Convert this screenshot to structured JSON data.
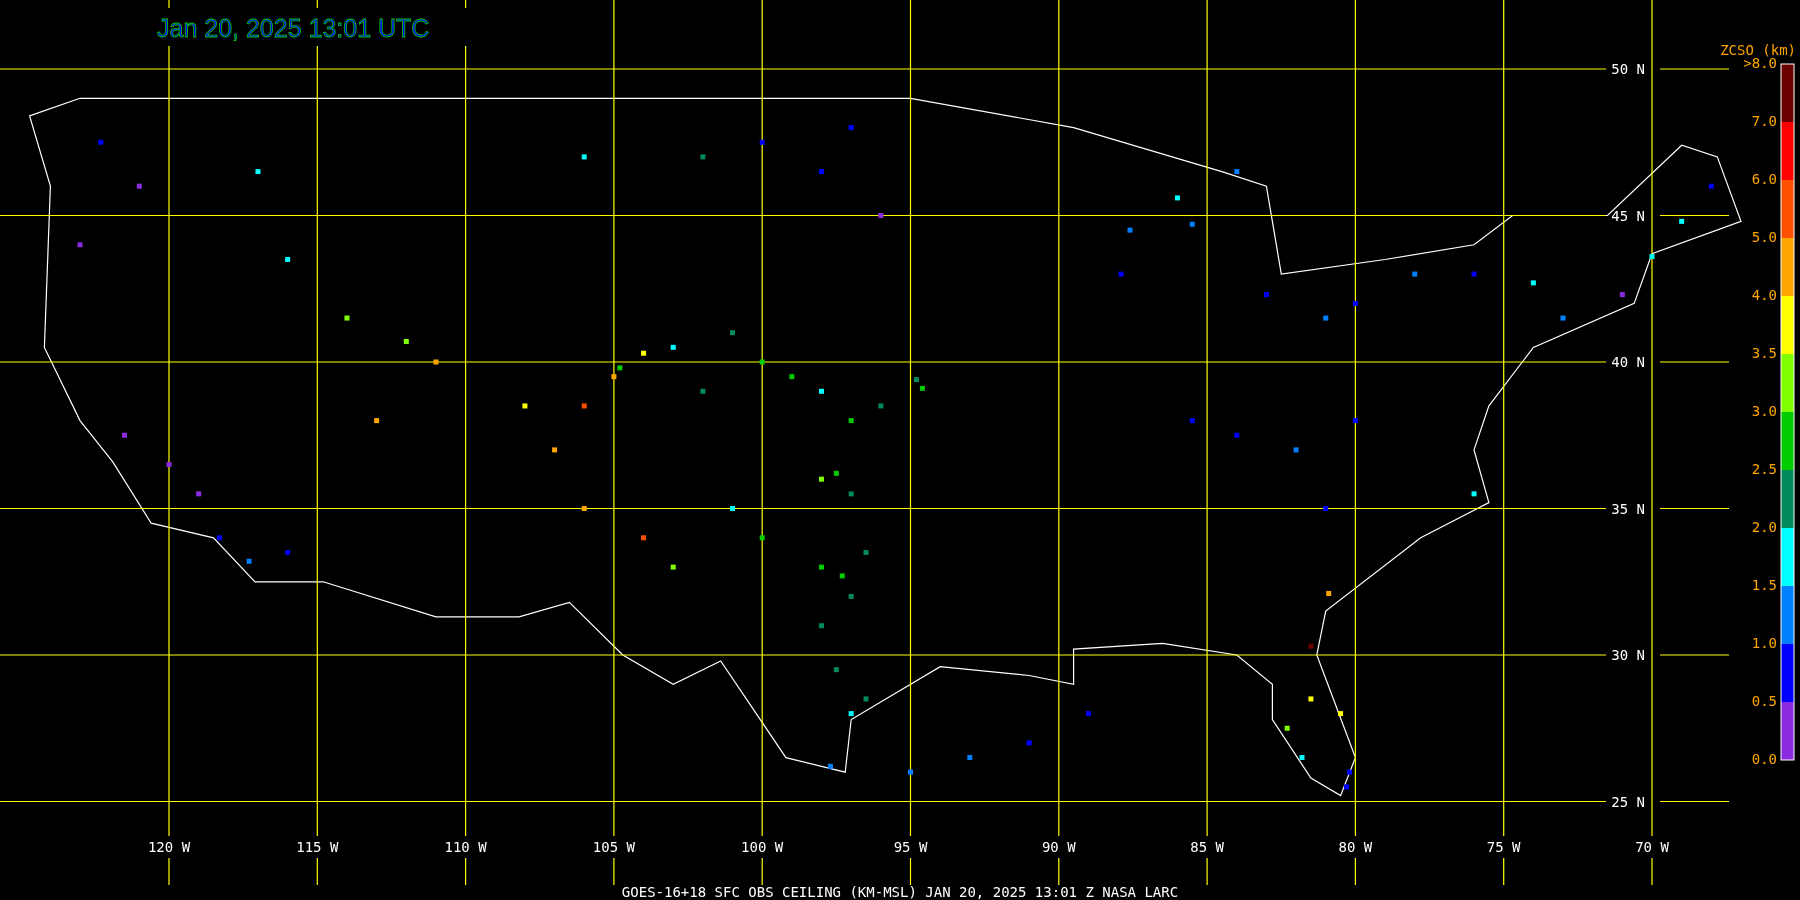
{
  "title": "Jan 20, 2025 13:01 UTC",
  "lat_labels": [
    "50 N",
    "45 N",
    "40 N",
    "35 N",
    "30 N",
    "25 N"
  ],
  "lon_labels": [
    "120 W",
    "115 W",
    "110 W",
    "105 W",
    "100 W",
    "95 W",
    "90 W",
    "85 W",
    "80 W",
    "75 W",
    "70 W"
  ],
  "legend": {
    "title": "ZCSO (km)",
    "labels": [
      ">8.0",
      "7.0",
      "6.0",
      "5.0",
      "4.0",
      "3.5",
      "3.0",
      "2.5",
      "2.0",
      "1.5",
      "1.0",
      "0.5",
      "0.0"
    ],
    "segments": [
      {
        "color": "#8a2be2"
      },
      {
        "color": "#0000ff"
      },
      {
        "color": "#0080ff"
      },
      {
        "color": "#00ffff"
      },
      {
        "color": "#008b5a"
      },
      {
        "color": "#00cc00"
      },
      {
        "color": "#80ff00"
      },
      {
        "color": "#ffff00"
      },
      {
        "color": "#ffa500"
      },
      {
        "color": "#ff5000"
      },
      {
        "color": "#ff0000"
      },
      {
        "color": "#6b0000"
      }
    ]
  },
  "caption": "GOES-16+18  SFC OBS CEILING (KM-MSL)   JAN 20, 2025 13:01 Z   NASA LARC"
}
